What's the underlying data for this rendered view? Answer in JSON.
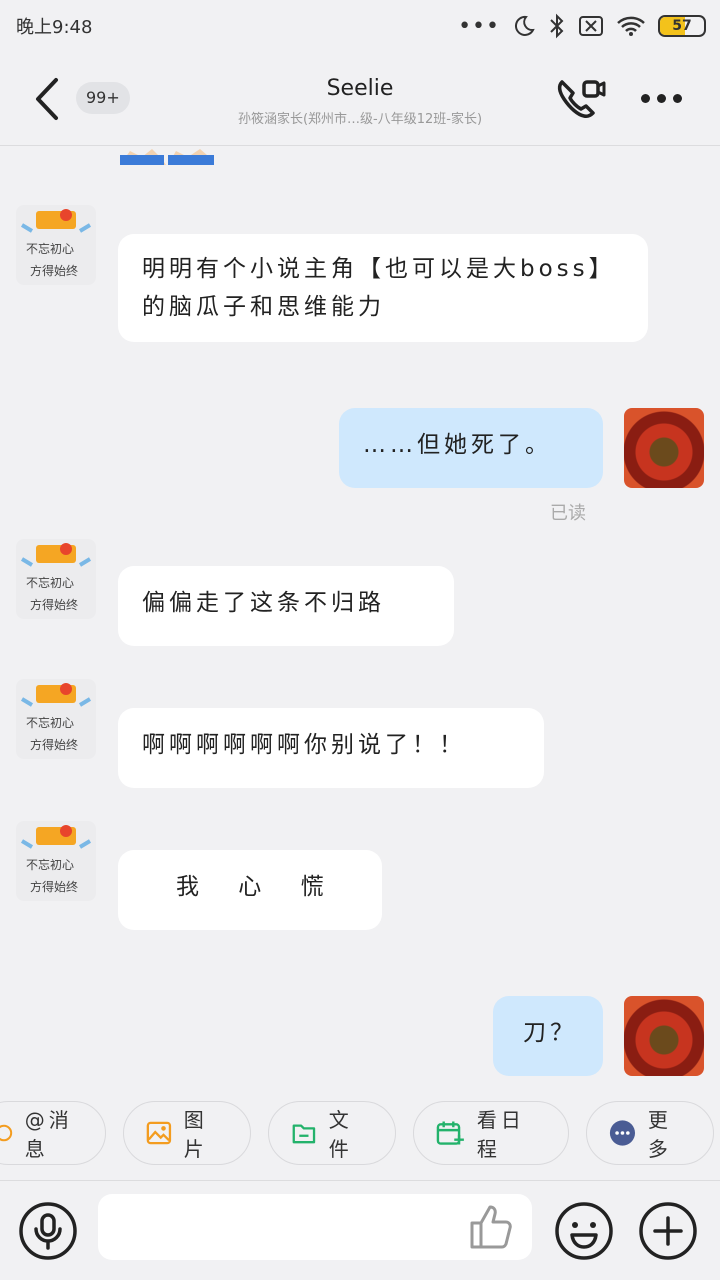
{
  "status_bar": {
    "time": "晚上9:48",
    "battery": "57",
    "battery_fraction": 0.57,
    "icons": [
      "dots-icon",
      "moon-icon",
      "bluetooth-icon",
      "sim-off-icon",
      "wifi-icon",
      "battery-icon"
    ]
  },
  "header": {
    "unread_badge": "99+",
    "title": "Seelie",
    "subtitle": "孙筱涵家长(郑州市…级-八年级12班-家长)"
  },
  "messages": [
    {
      "side": "left",
      "text": "明明有个小说主角【也可以是大boss】的脑瓜子和思维能力"
    },
    {
      "side": "right",
      "text": "……但她死了。"
    },
    {
      "side": "left",
      "text": "偏偏走了这条不归路"
    },
    {
      "side": "left",
      "text": "啊啊啊啊啊啊你别说了！！"
    },
    {
      "side": "left",
      "text": "我 心 慌"
    },
    {
      "side": "right",
      "text": "刀？"
    }
  ],
  "read_status": "已读",
  "toolbar": {
    "items": [
      {
        "label": "@消息",
        "icon": "at-icon"
      },
      {
        "label": "图片",
        "icon": "image-icon"
      },
      {
        "label": "文件",
        "icon": "folder-icon"
      },
      {
        "label": "看日程",
        "icon": "calendar-add-icon"
      },
      {
        "label": "更多",
        "icon": "more-circle-icon"
      }
    ]
  },
  "input": {
    "placeholder": ""
  },
  "colors": {
    "background": "#f1f1f3",
    "bubble_left": "#ffffff",
    "bubble_right": "#cfe8fd",
    "image_icon": "#f39c1f",
    "folder_icon": "#23b26b",
    "calendar_icon": "#23b26b",
    "more_icon": "#4a5c94"
  }
}
